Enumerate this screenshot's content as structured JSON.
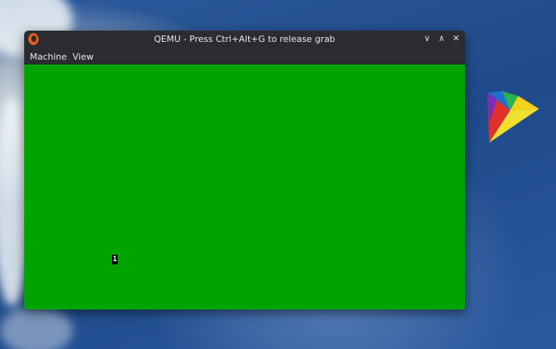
{
  "window": {
    "title": "QEMU - Press Ctrl+Alt+G to release grab",
    "minimize": "∨",
    "maximize": "∧",
    "close": "✕"
  },
  "menubar": {
    "items": [
      "Machine",
      "View"
    ]
  },
  "guest": {
    "background": "#00a400",
    "cursor_char": "1"
  }
}
